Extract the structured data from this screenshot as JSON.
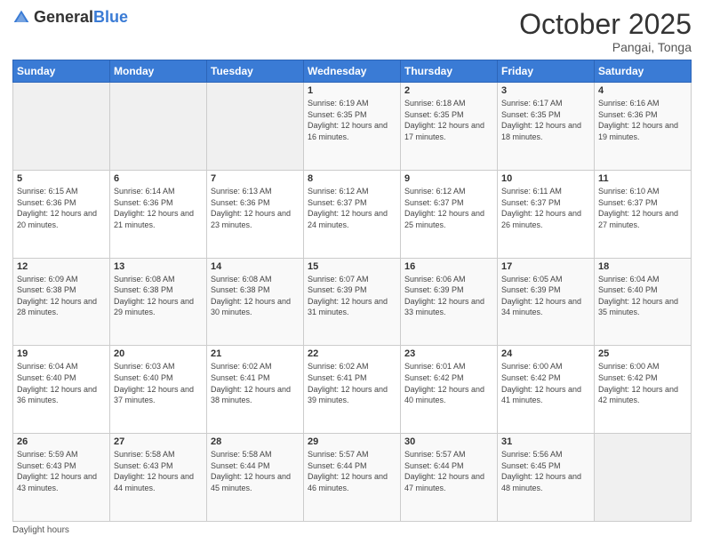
{
  "header": {
    "logo_general": "General",
    "logo_blue": "Blue",
    "month": "October 2025",
    "location": "Pangai, Tonga"
  },
  "weekdays": [
    "Sunday",
    "Monday",
    "Tuesday",
    "Wednesday",
    "Thursday",
    "Friday",
    "Saturday"
  ],
  "footer": {
    "daylight_label": "Daylight hours"
  },
  "weeks": [
    [
      {
        "day": "",
        "sunrise": "",
        "sunset": "",
        "daylight": ""
      },
      {
        "day": "",
        "sunrise": "",
        "sunset": "",
        "daylight": ""
      },
      {
        "day": "",
        "sunrise": "",
        "sunset": "",
        "daylight": ""
      },
      {
        "day": "1",
        "sunrise": "6:19 AM",
        "sunset": "6:35 PM",
        "daylight": "12 hours and 16 minutes."
      },
      {
        "day": "2",
        "sunrise": "6:18 AM",
        "sunset": "6:35 PM",
        "daylight": "12 hours and 17 minutes."
      },
      {
        "day": "3",
        "sunrise": "6:17 AM",
        "sunset": "6:35 PM",
        "daylight": "12 hours and 18 minutes."
      },
      {
        "day": "4",
        "sunrise": "6:16 AM",
        "sunset": "6:36 PM",
        "daylight": "12 hours and 19 minutes."
      }
    ],
    [
      {
        "day": "5",
        "sunrise": "6:15 AM",
        "sunset": "6:36 PM",
        "daylight": "12 hours and 20 minutes."
      },
      {
        "day": "6",
        "sunrise": "6:14 AM",
        "sunset": "6:36 PM",
        "daylight": "12 hours and 21 minutes."
      },
      {
        "day": "7",
        "sunrise": "6:13 AM",
        "sunset": "6:36 PM",
        "daylight": "12 hours and 23 minutes."
      },
      {
        "day": "8",
        "sunrise": "6:12 AM",
        "sunset": "6:37 PM",
        "daylight": "12 hours and 24 minutes."
      },
      {
        "day": "9",
        "sunrise": "6:12 AM",
        "sunset": "6:37 PM",
        "daylight": "12 hours and 25 minutes."
      },
      {
        "day": "10",
        "sunrise": "6:11 AM",
        "sunset": "6:37 PM",
        "daylight": "12 hours and 26 minutes."
      },
      {
        "day": "11",
        "sunrise": "6:10 AM",
        "sunset": "6:37 PM",
        "daylight": "12 hours and 27 minutes."
      }
    ],
    [
      {
        "day": "12",
        "sunrise": "6:09 AM",
        "sunset": "6:38 PM",
        "daylight": "12 hours and 28 minutes."
      },
      {
        "day": "13",
        "sunrise": "6:08 AM",
        "sunset": "6:38 PM",
        "daylight": "12 hours and 29 minutes."
      },
      {
        "day": "14",
        "sunrise": "6:08 AM",
        "sunset": "6:38 PM",
        "daylight": "12 hours and 30 minutes."
      },
      {
        "day": "15",
        "sunrise": "6:07 AM",
        "sunset": "6:39 PM",
        "daylight": "12 hours and 31 minutes."
      },
      {
        "day": "16",
        "sunrise": "6:06 AM",
        "sunset": "6:39 PM",
        "daylight": "12 hours and 33 minutes."
      },
      {
        "day": "17",
        "sunrise": "6:05 AM",
        "sunset": "6:39 PM",
        "daylight": "12 hours and 34 minutes."
      },
      {
        "day": "18",
        "sunrise": "6:04 AM",
        "sunset": "6:40 PM",
        "daylight": "12 hours and 35 minutes."
      }
    ],
    [
      {
        "day": "19",
        "sunrise": "6:04 AM",
        "sunset": "6:40 PM",
        "daylight": "12 hours and 36 minutes."
      },
      {
        "day": "20",
        "sunrise": "6:03 AM",
        "sunset": "6:40 PM",
        "daylight": "12 hours and 37 minutes."
      },
      {
        "day": "21",
        "sunrise": "6:02 AM",
        "sunset": "6:41 PM",
        "daylight": "12 hours and 38 minutes."
      },
      {
        "day": "22",
        "sunrise": "6:02 AM",
        "sunset": "6:41 PM",
        "daylight": "12 hours and 39 minutes."
      },
      {
        "day": "23",
        "sunrise": "6:01 AM",
        "sunset": "6:42 PM",
        "daylight": "12 hours and 40 minutes."
      },
      {
        "day": "24",
        "sunrise": "6:00 AM",
        "sunset": "6:42 PM",
        "daylight": "12 hours and 41 minutes."
      },
      {
        "day": "25",
        "sunrise": "6:00 AM",
        "sunset": "6:42 PM",
        "daylight": "12 hours and 42 minutes."
      }
    ],
    [
      {
        "day": "26",
        "sunrise": "5:59 AM",
        "sunset": "6:43 PM",
        "daylight": "12 hours and 43 minutes."
      },
      {
        "day": "27",
        "sunrise": "5:58 AM",
        "sunset": "6:43 PM",
        "daylight": "12 hours and 44 minutes."
      },
      {
        "day": "28",
        "sunrise": "5:58 AM",
        "sunset": "6:44 PM",
        "daylight": "12 hours and 45 minutes."
      },
      {
        "day": "29",
        "sunrise": "5:57 AM",
        "sunset": "6:44 PM",
        "daylight": "12 hours and 46 minutes."
      },
      {
        "day": "30",
        "sunrise": "5:57 AM",
        "sunset": "6:44 PM",
        "daylight": "12 hours and 47 minutes."
      },
      {
        "day": "31",
        "sunrise": "5:56 AM",
        "sunset": "6:45 PM",
        "daylight": "12 hours and 48 minutes."
      },
      {
        "day": "",
        "sunrise": "",
        "sunset": "",
        "daylight": ""
      }
    ]
  ]
}
